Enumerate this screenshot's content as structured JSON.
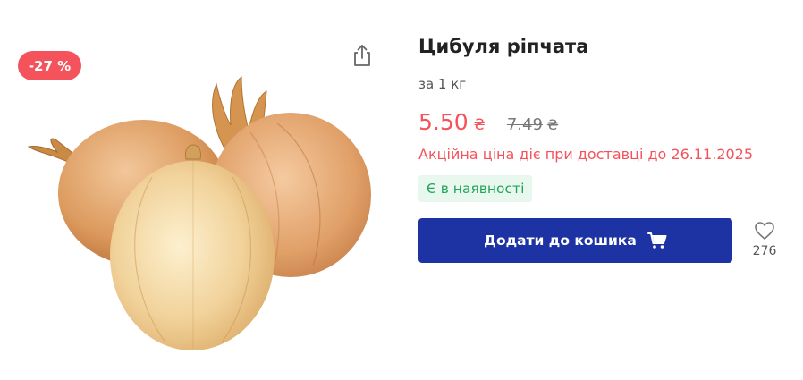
{
  "product": {
    "discount_badge": "-27 %",
    "title": "Цибуля ріпчата",
    "unit": "за 1 кг",
    "price_current": "5.50",
    "price_old": "7.49",
    "currency_symbol": "₴",
    "promo_text": "Акційна ціна діє при доставці до 26.11.2025",
    "stock_status": "Є в наявності",
    "add_to_cart_label": "Додати до кошика",
    "favorites_count": "276"
  },
  "icons": {
    "share": "share-icon",
    "cart": "cart-icon",
    "favorite": "heart-icon"
  },
  "colors": {
    "accent_red": "#f4535c",
    "button_blue": "#1e33a3",
    "stock_green": "#22a55a",
    "stock_bg": "#e9f8ee"
  }
}
